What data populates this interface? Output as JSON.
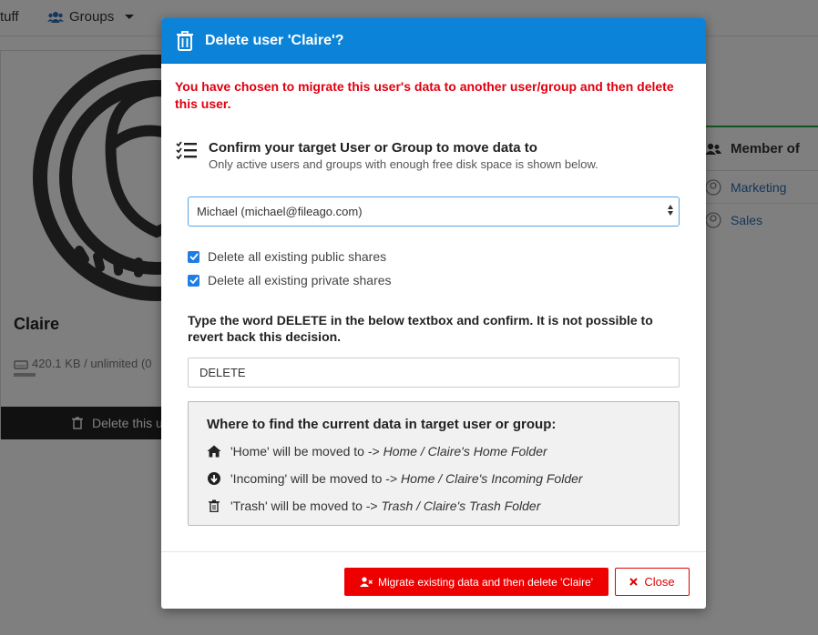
{
  "nav": {
    "stuff_label": "tuff",
    "groups_label": "Groups"
  },
  "user_card": {
    "name": "Claire",
    "storage": "420.1 KB / unlimited (0",
    "delete_label": "Delete this u"
  },
  "member_panel": {
    "title": "Member of",
    "items": [
      "Marketing",
      "Sales"
    ]
  },
  "modal": {
    "title": "Delete user 'Claire'?",
    "warning": "You have chosen to migrate this user's data to another user/group and then delete this user.",
    "target_title": "Confirm your target User or Group to move data to",
    "target_subtitle": "Only active users and groups with enough free disk space is shown below.",
    "target_select": "Michael (michael@fileago.com)",
    "checkboxes": [
      {
        "label": "Delete all existing public shares",
        "checked": true
      },
      {
        "label": "Delete all existing private shares",
        "checked": true
      }
    ],
    "instruction": "Type the word DELETE in the below textbox and confirm. It is not possible to revert back this decision.",
    "confirm_input": "DELETE",
    "info": {
      "heading": "Where to find the current data in target user or group:",
      "lines": [
        {
          "icon": "home-icon",
          "text": "'Home' will be moved to -> ",
          "path": "Home / Claire's Home Folder"
        },
        {
          "icon": "arrow-circle-down-icon",
          "text": "'Incoming' will be moved to -> ",
          "path": "Home / Claire's Incoming Folder"
        },
        {
          "icon": "trash-icon",
          "text": "'Trash' will be moved to -> ",
          "path": "Trash / Claire's Trash Folder"
        }
      ]
    },
    "migrate_button": "Migrate existing data and then delete 'Claire'",
    "close_button": "Close"
  },
  "colors": {
    "header_blue": "#0b83d9",
    "danger_red": "#ee0000",
    "checkbox_blue": "#1f7de6"
  }
}
